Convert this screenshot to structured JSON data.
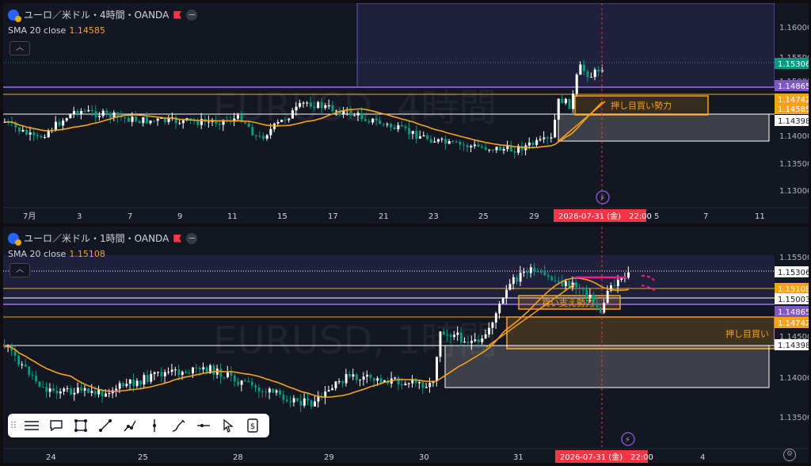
{
  "top": {
    "title": "ユーロ／米ドル・4時間・OANDA",
    "indicator_label": "SMA 20 close",
    "indicator_value": "1.14585",
    "watermark": "EURUSD, 4時間",
    "axis_prices": [
      "1.16000",
      "1.15500",
      "1.15000",
      "1.14000",
      "1.13500",
      "1.13000"
    ],
    "price_tags": [
      {
        "text": "1.15306",
        "color": "#089981"
      },
      {
        "text": "1.14865",
        "color": "#7e57c2"
      },
      {
        "text": "1.14742",
        "color": "#f7a21b"
      },
      {
        "text": "1.14585",
        "color": "#f7a21b"
      },
      {
        "text": "1.14398",
        "color": "#ffffff"
      }
    ],
    "annotation": "押し目買い勢力",
    "date_labels": [
      "7月",
      "3",
      "7",
      "9",
      "11",
      "15",
      "17",
      "21",
      "23",
      "25",
      "29",
      "5",
      "7",
      "11"
    ],
    "crosshair_date": "2026-07-31 (金)　22:00"
  },
  "bottom": {
    "title": "ユーロ／米ドル・1時間・OANDA",
    "indicator_label": "SMA 20 close",
    "indicator_value": "1.15108",
    "watermark": "EURUSD, 1時間",
    "axis_prices": [
      "1.15500",
      "1.14500",
      "1.14000",
      "1.13500"
    ],
    "price_tags": [
      {
        "text": "1.15306",
        "color": "#ffffff"
      },
      {
        "text": "1.15108",
        "color": "#f7a21b"
      },
      {
        "text": "1.15003",
        "color": "#ffffff"
      },
      {
        "text": "1.14865",
        "color": "#7e57c2"
      },
      {
        "text": "1.14742",
        "color": "#f7a21b"
      },
      {
        "text": "1.14398",
        "color": "#ffffff"
      }
    ],
    "annotation_support": "買い支え勢力",
    "annotation_dip": "押し目買い",
    "date_labels": [
      "24",
      "25",
      "28",
      "29",
      "30",
      "31",
      "4"
    ],
    "crosshair_date": "2026-07-31 (金)　22:00"
  },
  "toolbar": {
    "icons": [
      "grip-icon",
      "lines-icon",
      "comment-icon",
      "rectangle-icon",
      "trendline-icon",
      "path-icon",
      "vertical-line-icon",
      "brush-icon",
      "horizontal-ray-icon",
      "cursor-icon",
      "price-label-icon"
    ]
  }
}
